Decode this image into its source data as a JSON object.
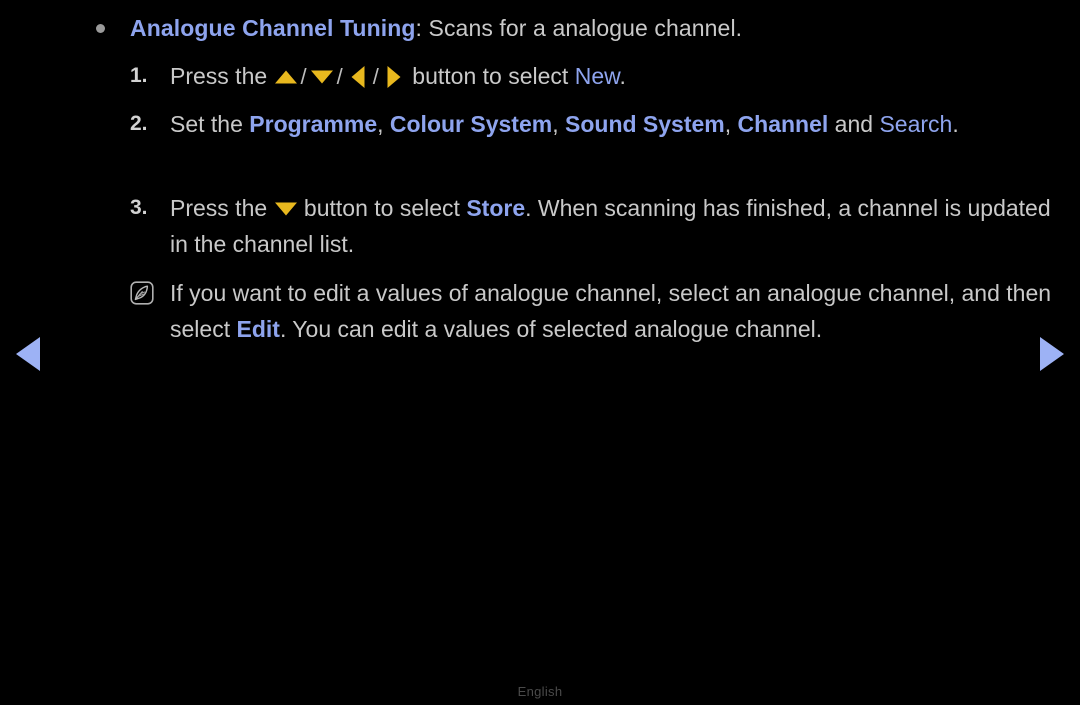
{
  "page": {
    "background_color": "#000000",
    "body_text_color": "#c9c9c9",
    "accent_blue": "#8ea4ee",
    "nav_arrow_color": "#9db2f5",
    "dpad_arrow_color": "#e8b81e"
  },
  "heading": {
    "term": "Analogue Channel Tuning",
    "separator": ": ",
    "description": "Scans for a analogue channel."
  },
  "steps": [
    {
      "number": "1.",
      "prefix": "Press the ",
      "arrows": [
        "up-arrow",
        "down-arrow",
        "left-arrow",
        "right-arrow"
      ],
      "slash": "/",
      "middle": " button to select ",
      "target": "New",
      "suffix": "."
    },
    {
      "number": "2.",
      "prefix": "Set the ",
      "menu_items": [
        "Programme",
        "Colour System",
        "Sound System",
        "Channel"
      ],
      "comma": ", ",
      "conjunction": " and ",
      "final_item": "Search",
      "suffix": "."
    },
    {
      "number": "3.",
      "prefix": "Press the ",
      "arrows": [
        "down-arrow"
      ],
      "middle": " button to select ",
      "target": "Store",
      "suffix": ". When scanning has finished, a channel is updated in the channel list."
    }
  ],
  "note": {
    "icon": "note-feather-icon",
    "text_before": "If you want to edit a values of analogue channel, select an analogue channel, and then select ",
    "term": "Edit",
    "text_after": ". You can edit a values of selected analogue channel."
  },
  "navigation": {
    "previous_label": "previous-page-arrow",
    "next_label": "next-page-arrow"
  },
  "footer": {
    "language": "English"
  }
}
